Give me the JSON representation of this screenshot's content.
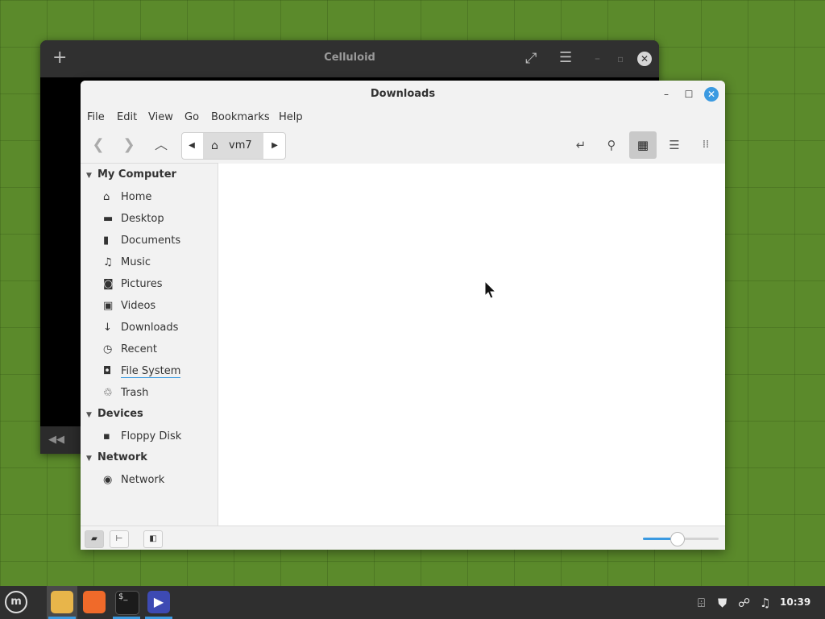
{
  "celluloid": {
    "title": "Celluloid",
    "icons": [
      "add-icon",
      "fullscreen-icon",
      "menu-icon",
      "minimize-icon",
      "maximize-icon",
      "close-icon",
      "rewind-icon"
    ]
  },
  "nemo": {
    "title": "Downloads",
    "menu": [
      "File",
      "Edit",
      "View",
      "Go",
      "Bookmarks",
      "Help"
    ],
    "path": {
      "crumb": "vm7"
    },
    "sections": [
      {
        "title": "My Computer",
        "items": [
          {
            "label": "Home",
            "icon": "home-icon"
          },
          {
            "label": "Desktop",
            "icon": "desktop-icon"
          },
          {
            "label": "Documents",
            "icon": "documents-icon"
          },
          {
            "label": "Music",
            "icon": "music-icon"
          },
          {
            "label": "Pictures",
            "icon": "pictures-icon"
          },
          {
            "label": "Videos",
            "icon": "videos-icon"
          },
          {
            "label": "Downloads",
            "icon": "downloads-icon"
          },
          {
            "label": "Recent",
            "icon": "recent-icon"
          },
          {
            "label": "File System",
            "icon": "filesystem-icon"
          },
          {
            "label": "Trash",
            "icon": "trash-icon"
          }
        ]
      },
      {
        "title": "Devices",
        "items": [
          {
            "label": "Floppy Disk",
            "icon": "floppy-icon"
          }
        ]
      },
      {
        "title": "Network",
        "items": [
          {
            "label": "Network",
            "icon": "network-icon"
          }
        ]
      }
    ],
    "zoom_level": 0.45
  },
  "taskbar": {
    "apps": [
      "file-manager",
      "firefox",
      "terminal",
      "celluloid"
    ],
    "clock": "10:39"
  },
  "colors": {
    "accent": "#3b9ae1",
    "desktop": "#5b8a2b"
  }
}
